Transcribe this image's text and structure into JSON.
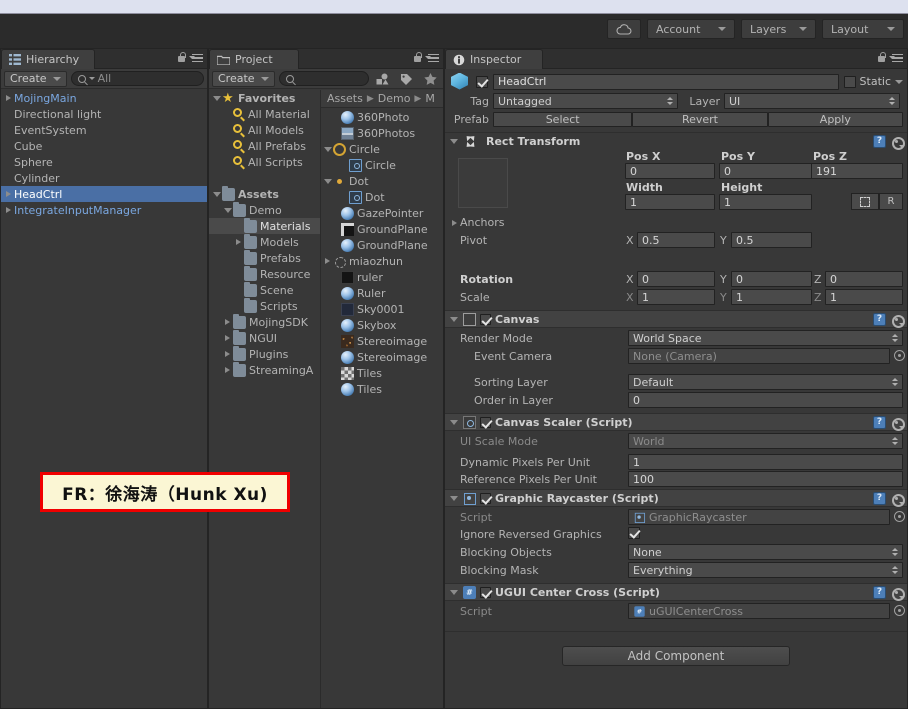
{
  "toolbar": {
    "cloud_icon": "cloud-icon",
    "account_label": "Account",
    "layers_label": "Layers",
    "layout_label": "Layout"
  },
  "hierarchy": {
    "tab_label": "Hierarchy",
    "tab_icon": "hierarchy-icon",
    "create_label": "Create",
    "search_value": "All",
    "items": [
      {
        "label": "MojingMain",
        "indent": 0,
        "arrow": "closed",
        "prefab": true,
        "selected": false
      },
      {
        "label": "Directional light",
        "indent": 1,
        "arrow": "none",
        "prefab": false,
        "selected": false
      },
      {
        "label": "EventSystem",
        "indent": 1,
        "arrow": "none",
        "prefab": false,
        "selected": false
      },
      {
        "label": "Cube",
        "indent": 1,
        "arrow": "none",
        "prefab": false,
        "selected": false
      },
      {
        "label": "Sphere",
        "indent": 1,
        "arrow": "none",
        "prefab": false,
        "selected": false
      },
      {
        "label": "Cylinder",
        "indent": 1,
        "arrow": "none",
        "prefab": false,
        "selected": false
      },
      {
        "label": "HeadCtrl",
        "indent": 0,
        "arrow": "closed",
        "prefab": true,
        "selected": true
      },
      {
        "label": "IntegrateInputManager",
        "indent": 0,
        "arrow": "closed",
        "prefab": true,
        "selected": false
      }
    ]
  },
  "project": {
    "tab_label": "Project",
    "tab_icon": "folder-icon",
    "create_label": "Create",
    "search_value": "",
    "tool_icons": [
      "filter-by-type-icon",
      "filter-by-label-icon",
      "favorites-star-icon"
    ],
    "breadcrumb": [
      "Assets",
      "Demo",
      "M"
    ],
    "tree": [
      {
        "label": "Favorites",
        "indent": 0,
        "arrow": "open",
        "icon": "star-icon",
        "bold": true
      },
      {
        "label": "All Material",
        "indent": 1,
        "arrow": "none",
        "icon": "search-saved-icon",
        "bold": false
      },
      {
        "label": "All Models",
        "indent": 1,
        "arrow": "none",
        "icon": "search-saved-icon",
        "bold": false
      },
      {
        "label": "All Prefabs",
        "indent": 1,
        "arrow": "none",
        "icon": "search-saved-icon",
        "bold": false
      },
      {
        "label": "All Scripts",
        "indent": 1,
        "arrow": "none",
        "icon": "search-saved-icon",
        "bold": false
      },
      {
        "label": "",
        "indent": 0,
        "arrow": "none",
        "icon": "spacer",
        "bold": false
      },
      {
        "label": "Assets",
        "indent": 0,
        "arrow": "open",
        "icon": "folder-icon",
        "bold": true
      },
      {
        "label": "Demo",
        "indent": 1,
        "arrow": "open",
        "icon": "folder-icon",
        "bold": false
      },
      {
        "label": "Materials",
        "indent": 2,
        "arrow": "none",
        "icon": "folder-icon",
        "bold": false,
        "selected": true
      },
      {
        "label": "Models",
        "indent": 2,
        "arrow": "closed",
        "icon": "folder-icon",
        "bold": false
      },
      {
        "label": "Prefabs",
        "indent": 2,
        "arrow": "none",
        "icon": "folder-icon",
        "bold": false
      },
      {
        "label": "Resource",
        "indent": 2,
        "arrow": "none",
        "icon": "folder-icon",
        "bold": false
      },
      {
        "label": "Scene",
        "indent": 2,
        "arrow": "none",
        "icon": "folder-icon",
        "bold": false
      },
      {
        "label": "Scripts",
        "indent": 2,
        "arrow": "none",
        "icon": "folder-icon",
        "bold": false
      },
      {
        "label": "MojingSDK",
        "indent": 1,
        "arrow": "closed",
        "icon": "folder-icon",
        "bold": false
      },
      {
        "label": "NGUI",
        "indent": 1,
        "arrow": "closed",
        "icon": "folder-icon",
        "bold": false
      },
      {
        "label": "Plugins",
        "indent": 1,
        "arrow": "closed",
        "icon": "folder-icon",
        "bold": false
      },
      {
        "label": "StreamingA",
        "indent": 1,
        "arrow": "closed",
        "icon": "folder-icon",
        "bold": false
      }
    ],
    "assets": [
      {
        "label": "360Photo",
        "indent": 1,
        "arrow": "none",
        "icon": "material-sphere-icon"
      },
      {
        "label": "360Photos",
        "indent": 1,
        "arrow": "none",
        "icon": "texture-icon"
      },
      {
        "label": "Circle",
        "indent": 0,
        "arrow": "open",
        "icon": "circle-outline-icon"
      },
      {
        "label": "Circle",
        "indent": 2,
        "arrow": "none",
        "icon": "sprite-icon"
      },
      {
        "label": "Dot",
        "indent": 0,
        "arrow": "open",
        "icon": "dot-icon"
      },
      {
        "label": "Dot",
        "indent": 2,
        "arrow": "none",
        "icon": "sprite-icon"
      },
      {
        "label": "GazePointer",
        "indent": 1,
        "arrow": "none",
        "icon": "material-sphere-icon"
      },
      {
        "label": "GroundPlane",
        "indent": 1,
        "arrow": "none",
        "icon": "texture-dark-icon"
      },
      {
        "label": "GroundPlane",
        "indent": 1,
        "arrow": "none",
        "icon": "material-sphere-icon"
      },
      {
        "label": "miaozhun",
        "indent": 0,
        "arrow": "closed",
        "icon": "gizmo-icon"
      },
      {
        "label": "ruler",
        "indent": 1,
        "arrow": "none",
        "icon": "texture-black-icon"
      },
      {
        "label": "Ruler",
        "indent": 1,
        "arrow": "none",
        "icon": "material-sphere-icon"
      },
      {
        "label": "Sky0001",
        "indent": 1,
        "arrow": "none",
        "icon": "texture-navy-icon"
      },
      {
        "label": "Skybox",
        "indent": 1,
        "arrow": "none",
        "icon": "material-sphere-icon"
      },
      {
        "label": "Stereoimage",
        "indent": 1,
        "arrow": "none",
        "icon": "texture-noise-icon"
      },
      {
        "label": "Stereoimage",
        "indent": 1,
        "arrow": "none",
        "icon": "material-sphere-icon"
      },
      {
        "label": "Tiles",
        "indent": 1,
        "arrow": "none",
        "icon": "texture-tiles-icon"
      },
      {
        "label": "Tiles",
        "indent": 1,
        "arrow": "none",
        "icon": "material-sphere-icon"
      }
    ]
  },
  "inspector": {
    "tab_label": "Inspector",
    "tab_icon": "info-icon",
    "object": {
      "enabled": true,
      "name": "HeadCtrl",
      "static_label": "Static",
      "static_checked": false,
      "tag_label": "Tag",
      "tag_value": "Untagged",
      "layer_label": "Layer",
      "layer_value": "UI"
    },
    "prefab": {
      "label": "Prefab",
      "select_label": "Select",
      "revert_label": "Revert",
      "apply_label": "Apply"
    },
    "rect_transform": {
      "title": "Rect Transform",
      "pos_x_label": "Pos X",
      "pos_x": "0",
      "pos_y_label": "Pos Y",
      "pos_y": "0",
      "pos_z_label": "Pos Z",
      "pos_z": "191",
      "width_label": "Width",
      "width": "1",
      "height_label": "Height",
      "height": "1",
      "blueprint_label": "",
      "raw_label": "R",
      "anchors_label": "Anchors",
      "pivot_label": "Pivot",
      "pivot_x": "0.5",
      "pivot_y": "0.5",
      "rotation_label": "Rotation",
      "rot_x": "0",
      "rot_y": "0",
      "rot_z": "0",
      "scale_label": "Scale",
      "scale_x": "1",
      "scale_y": "1",
      "scale_z": "1"
    },
    "canvas": {
      "title": "Canvas",
      "enabled": true,
      "render_mode_label": "Render Mode",
      "render_mode_value": "World Space",
      "event_camera_label": "Event Camera",
      "event_camera_value": "None (Camera)",
      "sorting_layer_label": "Sorting Layer",
      "sorting_layer_value": "Default",
      "order_in_layer_label": "Order in Layer",
      "order_in_layer_value": "0"
    },
    "canvas_scaler": {
      "title": "Canvas Scaler (Script)",
      "enabled": true,
      "ui_scale_mode_label": "UI Scale Mode",
      "ui_scale_mode_value": "World",
      "dynamic_ppu_label": "Dynamic Pixels Per Unit",
      "dynamic_ppu_value": "1",
      "reference_ppu_label": "Reference Pixels Per Unit",
      "reference_ppu_value": "100"
    },
    "graphic_raycaster": {
      "title": "Graphic Raycaster (Script)",
      "enabled": true,
      "script_label": "Script",
      "script_value": "GraphicRaycaster",
      "ignore_reversed_label": "Ignore Reversed Graphics",
      "ignore_reversed_checked": true,
      "blocking_objects_label": "Blocking Objects",
      "blocking_objects_value": "None",
      "blocking_mask_label": "Blocking Mask",
      "blocking_mask_value": "Everything"
    },
    "ugui_center_cross": {
      "title": "UGUI Center Cross (Script)",
      "enabled": true,
      "script_label": "Script",
      "script_value": "uGUICenterCross"
    },
    "add_component_label": "Add Component"
  },
  "watermark": {
    "text": "FR：徐海涛（Hunk Xu)",
    "border_color": "#f00000",
    "background_color": "#fbf6d4"
  }
}
